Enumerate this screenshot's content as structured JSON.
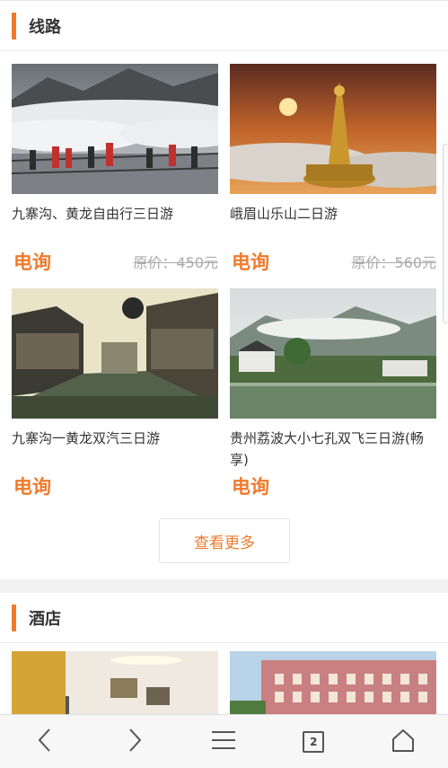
{
  "route_section": {
    "title": "线路",
    "cards": [
      {
        "name": "九寨沟、黄龙自由行三日游",
        "price": "电询",
        "original_price": "原价：450元"
      },
      {
        "name": "峨眉山乐山二日游",
        "price": "电询",
        "original_price": "原价：560元"
      },
      {
        "name": "九寨沟一黄龙双汽三日游",
        "price": "电询"
      },
      {
        "name": "贵州荔波大小七孔双飞三日游(畅享)",
        "price": "电询"
      }
    ],
    "more_button": "查看更多"
  },
  "hotel_section": {
    "title": "酒店"
  },
  "bottom_nav": {
    "tab_count": "2",
    "icons": [
      "back-icon",
      "forward-icon",
      "menu-icon",
      "tabs-icon",
      "home-icon"
    ]
  },
  "colors": {
    "accent": "#ef7a2c",
    "strike": "#aaaaaa"
  }
}
